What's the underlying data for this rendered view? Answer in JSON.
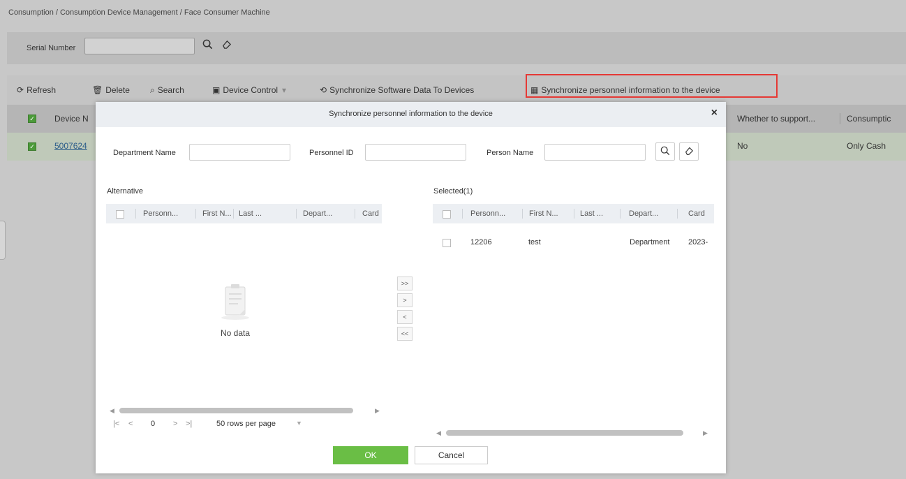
{
  "background": {
    "breadcrumb": "Consumption / Consumption Device Management / Face Consumer Machine",
    "filter": {
      "serial_number_label": "Serial Number",
      "serial_number_value": "",
      "search_icon": "search-icon",
      "clear_icon": "eraser-icon"
    },
    "toolbar": {
      "refresh": "Refresh",
      "delete": "Delete",
      "search": "Search",
      "device_control": "Device Control",
      "sync_software": "Synchronize Software Data To Devices",
      "sync_personnel": "Synchronize personnel information to the device"
    },
    "table": {
      "headers": [
        "Device N",
        "Whether to support...",
        "Consumptic"
      ],
      "row": {
        "device": "5007624",
        "support": "No",
        "consumption": "Only Cash"
      }
    },
    "highlight_color": "#e53935"
  },
  "modal": {
    "title": "Synchronize personnel information to the device",
    "close": "×",
    "filters": {
      "department_label": "Department Name",
      "department_value": "",
      "personnel_id_label": "Personnel ID",
      "personnel_id_value": "",
      "person_name_label": "Person Name",
      "person_name_value": ""
    },
    "alternative": {
      "title": "Alternative",
      "columns": [
        "Personn...",
        "First N...",
        "Last ...",
        "Depart...",
        "Card"
      ],
      "empty_text": "No data",
      "pager": {
        "first": "|<",
        "prev": "<",
        "page": "0",
        "next": ">",
        "last": ">|",
        "rows_per_page": "50 rows per page"
      }
    },
    "transfer": {
      "all_right": ">>",
      "right": ">",
      "left": "<",
      "all_left": "<<"
    },
    "selected": {
      "title": "Selected(1)",
      "columns": [
        "Personn...",
        "First N...",
        "Last ...",
        "Depart...",
        "Card"
      ],
      "rows": [
        {
          "personnel_id": "12206",
          "first_name": "test",
          "last_name": "",
          "department": "Department",
          "card": "2023-"
        }
      ]
    },
    "ok_label": "OK",
    "cancel_label": "Cancel",
    "ok_color": "#6abe45"
  }
}
